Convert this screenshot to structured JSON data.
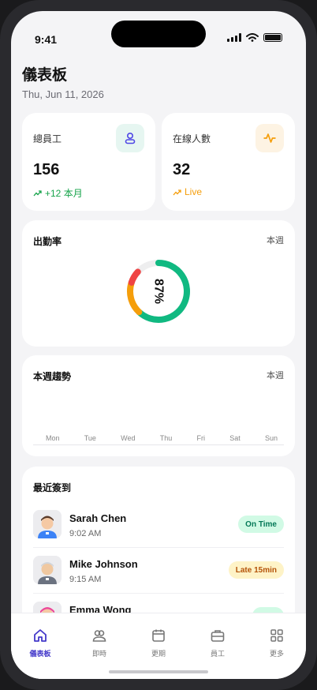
{
  "status_bar": {
    "time": "9:41"
  },
  "header": {
    "title": "儀表板",
    "date": "Thu, Jun 11, 2026"
  },
  "stats": [
    {
      "label": "總員工",
      "value": "156",
      "trend": "+12 本月",
      "trend_color": "#16a34a",
      "icon": "users-icon"
    },
    {
      "label": "在線人數",
      "value": "32",
      "trend": "Live",
      "trend_color": "#f59e0b",
      "icon": "activity-icon"
    }
  ],
  "attendance": {
    "title": "出勤率",
    "period": "本週",
    "percent_label": "87%",
    "segments": [
      {
        "name": "on-time",
        "fraction": 0.62,
        "color": "#10b981"
      },
      {
        "name": "late",
        "fraction": 0.18,
        "color": "#f59e0b"
      },
      {
        "name": "absent",
        "fraction": 0.07,
        "color": "#ef4444"
      }
    ]
  },
  "weekly_trend": {
    "title": "本週趨勢",
    "period": "本週",
    "days": [
      "Mon",
      "Tue",
      "Wed",
      "Thu",
      "Fri",
      "Sat",
      "Sun"
    ]
  },
  "recent_checkins": {
    "title": "最近簽到",
    "items": [
      {
        "name": "Sarah Chen",
        "time": "9:02 AM",
        "status": "On Time",
        "badge_bg": "#d1fae5",
        "badge_fg": "#047857"
      },
      {
        "name": "Mike Johnson",
        "time": "9:15 AM",
        "status": "Late 15min",
        "badge_bg": "#fef3c7",
        "badge_fg": "#b45309"
      },
      {
        "name": "Emma Wong",
        "time": "",
        "status": "",
        "badge_bg": "#d1fae5",
        "badge_fg": "#047857"
      }
    ]
  },
  "tabs": [
    {
      "label": "儀表板",
      "icon": "home-icon",
      "active": true
    },
    {
      "label": "即時",
      "icon": "people-icon",
      "active": false
    },
    {
      "label": "更期",
      "icon": "calendar-icon",
      "active": false
    },
    {
      "label": "員工",
      "icon": "briefcase-icon",
      "active": false
    },
    {
      "label": "更多",
      "icon": "grid-icon",
      "active": false
    }
  ],
  "colors": {
    "accent": "#4338ca",
    "background": "#f4f4f6"
  }
}
